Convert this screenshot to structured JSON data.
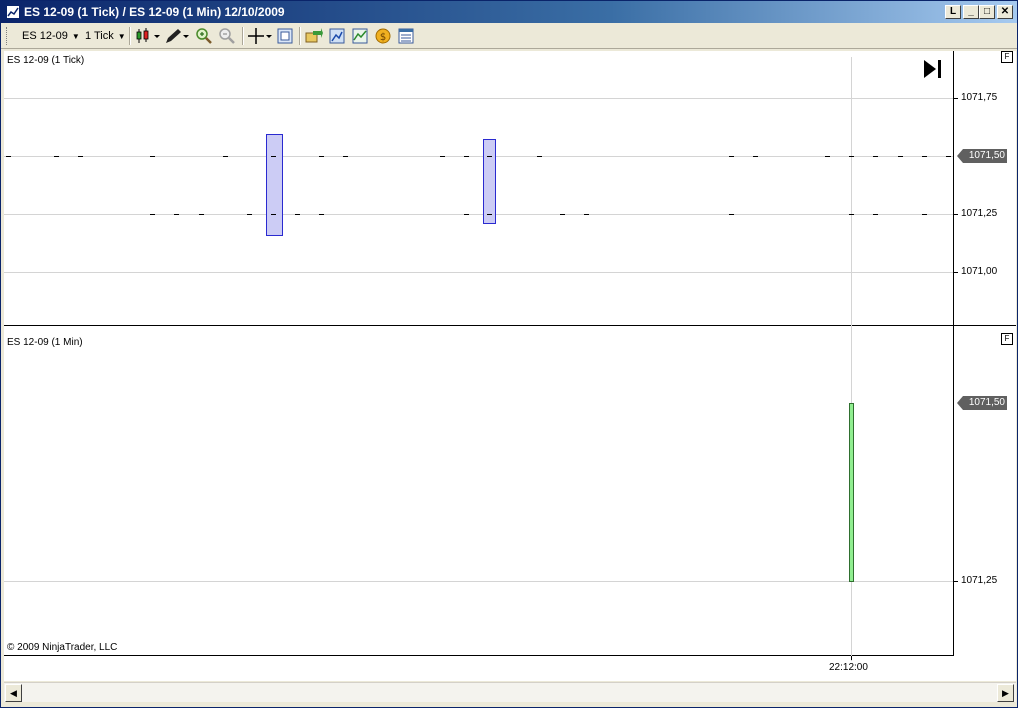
{
  "window": {
    "title": "ES 12-09 (1 Tick) / ES 12-09 (1 Min)  12/10/2009",
    "buttons": {
      "restore": "L",
      "minimize": "_",
      "maximize": "□",
      "close": "✕"
    }
  },
  "toolbar": {
    "instrument": "ES 12-09",
    "interval": "1 Tick",
    "icons": [
      "bar-type-icon",
      "drawing-pencil-icon",
      "zoom-in-icon",
      "zoom-out-icon",
      "crosshair-icon",
      "data-box-icon",
      "strategies-icon",
      "properties-icon",
      "indicators-icon",
      "currency-icon",
      "chart-properties-icon"
    ]
  },
  "panels": {
    "top": {
      "title": "ES 12-09 (1 Tick)",
      "flag": "F",
      "price_labels": [
        "1071,75",
        "1071,50",
        "1071,25",
        "1071,00"
      ],
      "last_price": "1071,50"
    },
    "bottom": {
      "title": "ES 12-09 (1 Min)",
      "flag": "F",
      "price_labels": [
        "1071,25"
      ],
      "last_price": "1071,50"
    }
  },
  "time_axis": {
    "label": "22:12:00"
  },
  "copyright": "© 2009 NinjaTrader, LLC",
  "colors": {
    "tick_highlight_fill": "#ccccf5",
    "tick_highlight_border": "#2a2ad0",
    "minute_bar_fill": "#90ee90",
    "minute_bar_border": "#2f6f2f",
    "price_tag": "#606060"
  }
}
